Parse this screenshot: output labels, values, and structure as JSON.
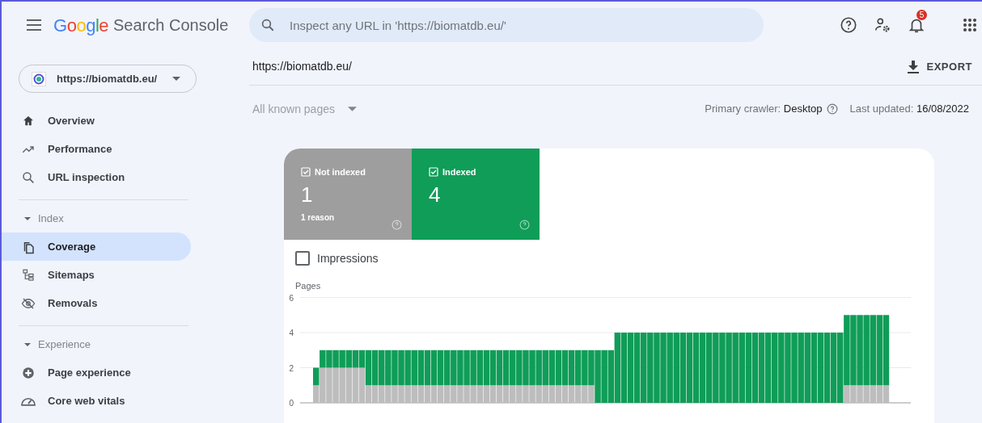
{
  "header": {
    "product_logo": "Google",
    "product_name": "Search Console",
    "search": {
      "placeholder": "Inspect any URL in 'https://biomatdb.eu/'"
    },
    "notification_count": "5"
  },
  "sidebar": {
    "property": "https://biomatdb.eu/",
    "items": [
      {
        "kind": "item",
        "label": "Overview",
        "selected": false
      },
      {
        "kind": "item",
        "label": "Performance",
        "selected": false
      },
      {
        "kind": "item",
        "label": "URL inspection",
        "selected": false
      },
      {
        "kind": "divider"
      },
      {
        "kind": "section",
        "label": "Index",
        "expanded": true
      },
      {
        "kind": "item",
        "label": "Coverage",
        "selected": true
      },
      {
        "kind": "item",
        "label": "Sitemaps",
        "selected": false
      },
      {
        "kind": "item",
        "label": "Removals",
        "selected": false
      },
      {
        "kind": "divider"
      },
      {
        "kind": "section",
        "label": "Experience",
        "expanded": true
      },
      {
        "kind": "item",
        "label": "Page experience",
        "selected": false
      },
      {
        "kind": "item",
        "label": "Core web vitals",
        "selected": false
      }
    ]
  },
  "main": {
    "breadcrumb": "https://biomatdb.eu/",
    "export_label": "EXPORT",
    "filter": "All known pages",
    "crawler_label": "Primary crawler:",
    "crawler_value": "Desktop",
    "updated_label": "Last updated:",
    "updated_value": "16/08/2022",
    "tiles": [
      {
        "label": "Not indexed",
        "value": "1",
        "sub": "1 reason",
        "checked": true,
        "color": "#9e9e9e"
      },
      {
        "label": "Indexed",
        "value": "4",
        "checked": true,
        "color": "#0f9d58"
      }
    ],
    "impressions": {
      "label": "Impressions",
      "checked": false
    },
    "chart_data": {
      "type": "bar",
      "stacked": true,
      "ylabel": "Pages",
      "ylim": [
        0,
        6
      ],
      "yticks": [
        0,
        2,
        4,
        6
      ],
      "series": [
        {
          "color": "#bdbdbd",
          "values": [
            1,
            2,
            2,
            2,
            2,
            2,
            2,
            2,
            1,
            1,
            1,
            1,
            1,
            1,
            1,
            1,
            1,
            1,
            1,
            1,
            1,
            1,
            1,
            1,
            1,
            1,
            1,
            1,
            1,
            1,
            1,
            1,
            1,
            1,
            1,
            1,
            1,
            1,
            1,
            1,
            1,
            1,
            1,
            0,
            0,
            0,
            0,
            0,
            0,
            0,
            0,
            0,
            0,
            0,
            0,
            0,
            0,
            0,
            0,
            0,
            0,
            0,
            0,
            0,
            0,
            0,
            0,
            0,
            0,
            0,
            0,
            0,
            0,
            0,
            0,
            0,
            0,
            0,
            0,
            0,
            0,
            1,
            1,
            1,
            1,
            1,
            1,
            1
          ]
        },
        {
          "color": "#0f9d58",
          "values": [
            1,
            1,
            1,
            1,
            1,
            1,
            1,
            1,
            2,
            2,
            2,
            2,
            2,
            2,
            2,
            2,
            2,
            2,
            2,
            2,
            2,
            2,
            2,
            2,
            2,
            2,
            2,
            2,
            2,
            2,
            2,
            2,
            2,
            2,
            2,
            2,
            2,
            2,
            2,
            2,
            2,
            2,
            2,
            3,
            3,
            3,
            4,
            4,
            4,
            4,
            4,
            4,
            4,
            4,
            4,
            4,
            4,
            4,
            4,
            4,
            4,
            4,
            4,
            4,
            4,
            4,
            4,
            4,
            4,
            4,
            4,
            4,
            4,
            4,
            4,
            4,
            4,
            4,
            4,
            4,
            4,
            4,
            4,
            4,
            4,
            4,
            4,
            4
          ]
        }
      ]
    }
  }
}
